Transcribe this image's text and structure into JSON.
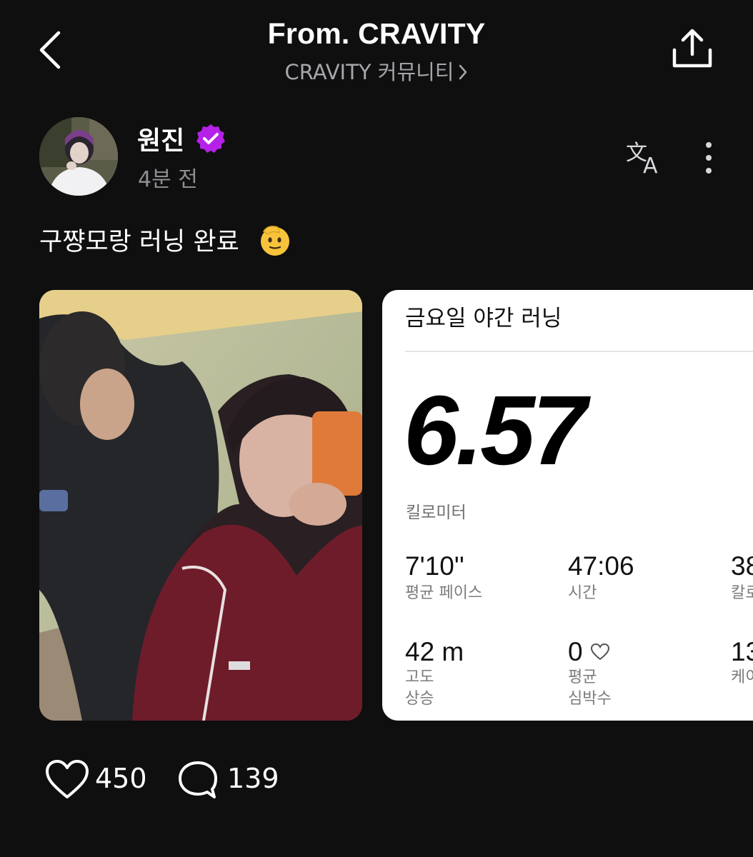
{
  "header": {
    "title": "From. CRAVITY",
    "community": "CRAVITY 커뮤니티",
    "back_icon": "chevron-left-icon",
    "share_icon": "share-upload-icon"
  },
  "post": {
    "author": "원진",
    "verified_color": "#b621e8",
    "time_ago": "4분 전",
    "text": "구쨩모랑 러닝 완료",
    "emoji": "saluting-face-emoji",
    "translate_icon": "translate-icon",
    "more_icon": "more-vertical-icon"
  },
  "run_card": {
    "title": "금요일 야간 러닝",
    "distance": "6.57",
    "distance_unit": "킬로미터",
    "stats": [
      {
        "value": "7'10''",
        "label": "평균 페이스"
      },
      {
        "value": "47:06",
        "label": "시간"
      },
      {
        "value": "38",
        "label": "칼로"
      },
      {
        "value": "42 m",
        "label_line1": "고도",
        "label_line2": "상승"
      },
      {
        "value": "0",
        "label_line1": "평균",
        "label_line2": "심박수"
      },
      {
        "value": "13",
        "label": "케이"
      }
    ]
  },
  "actions": {
    "likes": "450",
    "comments": "139",
    "like_icon": "heart-icon",
    "comment_icon": "comment-bubble-icon"
  }
}
